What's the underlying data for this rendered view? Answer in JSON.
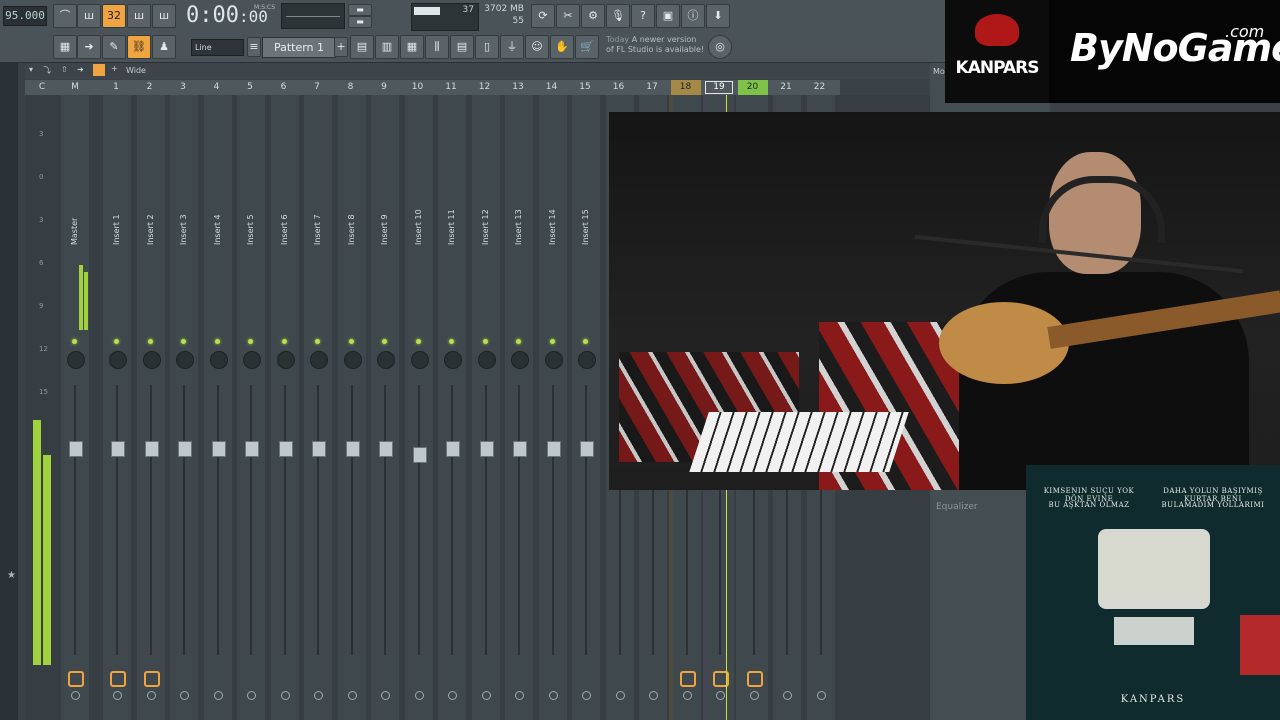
{
  "toolbar": {
    "tempo": "95.000",
    "time": "0:00",
    "time_frac": ":00",
    "time_unit": "M:S:CS",
    "cpu_value": "37",
    "cpu_fraction": 0.42,
    "memory": "3702 MB",
    "polyphony": "55",
    "snap": "Line",
    "pattern": "Pattern 1",
    "news_date": "Today",
    "news_text": "A newer version of FL Studio is available!",
    "btn_32": "32"
  },
  "mixer": {
    "view_mode": "Wide",
    "header_c": "C",
    "header_m": "M",
    "columns": [
      "1",
      "2",
      "3",
      "4",
      "5",
      "6",
      "7",
      "8",
      "9",
      "10",
      "11",
      "12",
      "13",
      "14",
      "15",
      "16",
      "17",
      "18",
      "19",
      "20",
      "21",
      "22"
    ],
    "selected_column": "19",
    "tracks": [
      "Master",
      "Insert 1",
      "Insert 2",
      "Insert 3",
      "Insert 4",
      "Insert 5",
      "Insert 6",
      "Insert 7",
      "Insert 8",
      "Insert 9",
      "Insert 10",
      "Insert 11",
      "Insert 12",
      "Insert 13",
      "Insert 14",
      "Insert 15"
    ],
    "meter_ticks": [
      "3",
      "0",
      "3",
      "6",
      "9",
      "12",
      "15"
    ],
    "equalizer": "Equalizer",
    "side_panel_title": "Mo"
  },
  "overlay": {
    "brand_logo": "KANPARS",
    "brand_name": "ByNoGame",
    "brand_suffix": ".com"
  },
  "album": {
    "left_lines": [
      "KIMSENIN SUÇU YOK",
      "DÖN EVINE",
      "BU AŞKTAN OLMAZ"
    ],
    "right_lines": [
      "DAHA YOLUN BAŞIYMIŞ",
      "KURTAR BENI",
      "BULAMADIM YOLLARIMI"
    ],
    "title": "KANPARS"
  },
  "colors": {
    "accent": "#f0a440",
    "meter": "#9fd23c",
    "highlight_yellow": "#a48a46",
    "highlight_green": "#7ec24a"
  }
}
